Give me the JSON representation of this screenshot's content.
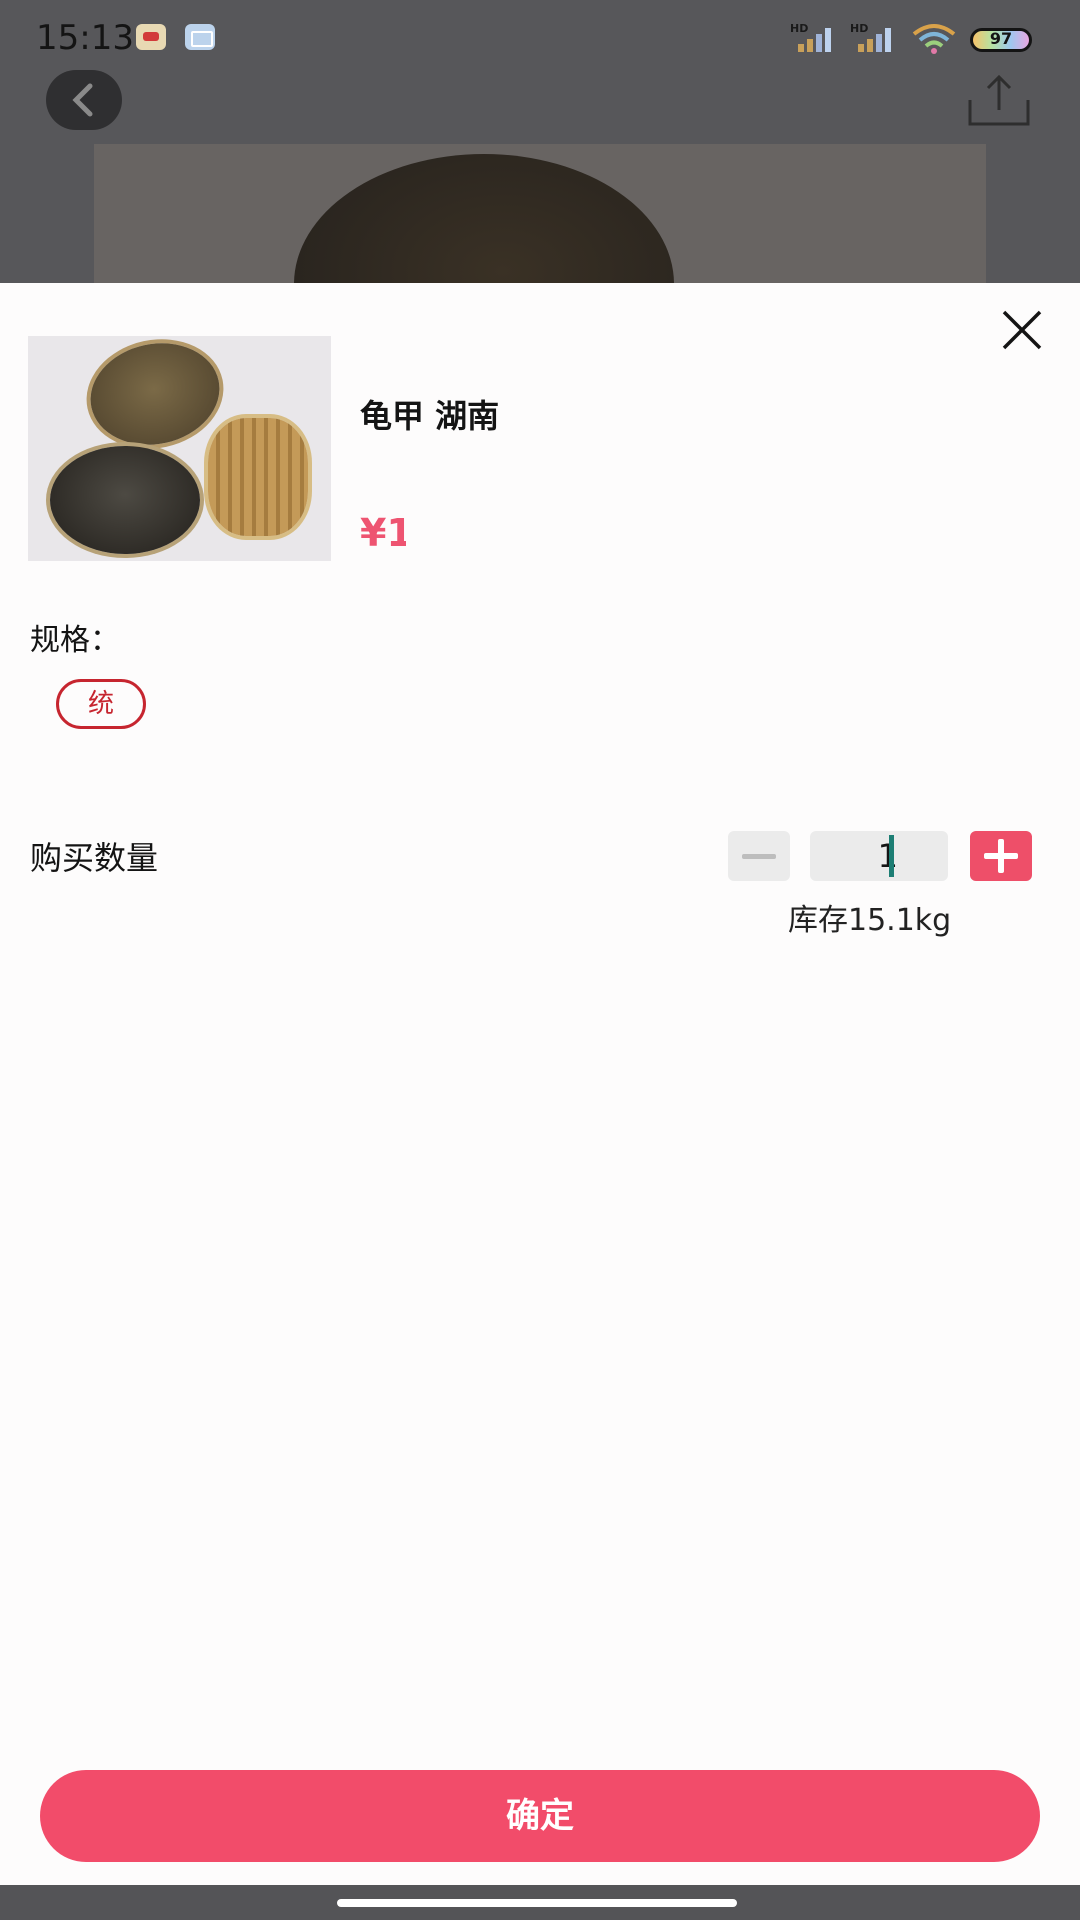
{
  "status_bar": {
    "time": "15:13",
    "network_1": "HD",
    "network_2": "HD",
    "battery": "97"
  },
  "product": {
    "name": "龟甲 湖南",
    "price": "¥1    .0",
    "image_icon": "product-image"
  },
  "spec": {
    "label": "规格：",
    "options": [
      "统"
    ],
    "selected": "统"
  },
  "quantity": {
    "label": "购买数量",
    "value": "1",
    "stock": "库存15.1kg"
  },
  "actions": {
    "confirm_label": "确定"
  },
  "colors": {
    "accent": "#f24c6a",
    "price": "#ee5471",
    "chip_border": "#c6252f"
  }
}
